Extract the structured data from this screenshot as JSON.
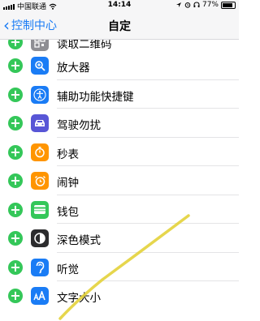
{
  "status_bar": {
    "carrier": "中国联通",
    "time": "14:14",
    "battery": "77%"
  },
  "nav": {
    "back_label": "控制中心",
    "title": "自定"
  },
  "rows": [
    {
      "label": "读取二维码",
      "icon": "qr-code-icon"
    },
    {
      "label": "放大器",
      "icon": "magnifier-icon"
    },
    {
      "label": "辅助功能快捷键",
      "icon": "accessibility-icon"
    },
    {
      "label": "驾驶勿扰",
      "icon": "car-icon"
    },
    {
      "label": "秒表",
      "icon": "stopwatch-icon"
    },
    {
      "label": "闹钟",
      "icon": "alarm-icon"
    },
    {
      "label": "钱包",
      "icon": "wallet-icon"
    },
    {
      "label": "深色模式",
      "icon": "dark-mode-icon"
    },
    {
      "label": "听觉",
      "icon": "ear-icon"
    },
    {
      "label": "文字大小",
      "icon": "text-size-icon"
    }
  ],
  "colors": {
    "accent": "#1a7cf5",
    "add_button": "#34c759",
    "annotation_stroke": "#e3d23a"
  }
}
